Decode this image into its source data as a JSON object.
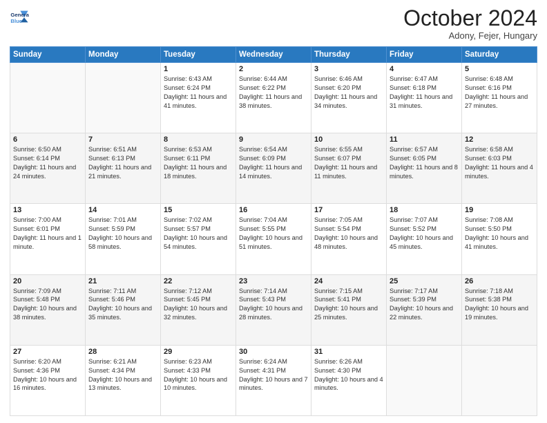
{
  "header": {
    "logo_line1": "General",
    "logo_line2": "Blue",
    "month": "October 2024",
    "location": "Adony, Fejer, Hungary"
  },
  "weekdays": [
    "Sunday",
    "Monday",
    "Tuesday",
    "Wednesday",
    "Thursday",
    "Friday",
    "Saturday"
  ],
  "weeks": [
    [
      {
        "day": "",
        "sunrise": "",
        "sunset": "",
        "daylight": ""
      },
      {
        "day": "",
        "sunrise": "",
        "sunset": "",
        "daylight": ""
      },
      {
        "day": "1",
        "sunrise": "Sunrise: 6:43 AM",
        "sunset": "Sunset: 6:24 PM",
        "daylight": "Daylight: 11 hours and 41 minutes."
      },
      {
        "day": "2",
        "sunrise": "Sunrise: 6:44 AM",
        "sunset": "Sunset: 6:22 PM",
        "daylight": "Daylight: 11 hours and 38 minutes."
      },
      {
        "day": "3",
        "sunrise": "Sunrise: 6:46 AM",
        "sunset": "Sunset: 6:20 PM",
        "daylight": "Daylight: 11 hours and 34 minutes."
      },
      {
        "day": "4",
        "sunrise": "Sunrise: 6:47 AM",
        "sunset": "Sunset: 6:18 PM",
        "daylight": "Daylight: 11 hours and 31 minutes."
      },
      {
        "day": "5",
        "sunrise": "Sunrise: 6:48 AM",
        "sunset": "Sunset: 6:16 PM",
        "daylight": "Daylight: 11 hours and 27 minutes."
      }
    ],
    [
      {
        "day": "6",
        "sunrise": "Sunrise: 6:50 AM",
        "sunset": "Sunset: 6:14 PM",
        "daylight": "Daylight: 11 hours and 24 minutes."
      },
      {
        "day": "7",
        "sunrise": "Sunrise: 6:51 AM",
        "sunset": "Sunset: 6:13 PM",
        "daylight": "Daylight: 11 hours and 21 minutes."
      },
      {
        "day": "8",
        "sunrise": "Sunrise: 6:53 AM",
        "sunset": "Sunset: 6:11 PM",
        "daylight": "Daylight: 11 hours and 18 minutes."
      },
      {
        "day": "9",
        "sunrise": "Sunrise: 6:54 AM",
        "sunset": "Sunset: 6:09 PM",
        "daylight": "Daylight: 11 hours and 14 minutes."
      },
      {
        "day": "10",
        "sunrise": "Sunrise: 6:55 AM",
        "sunset": "Sunset: 6:07 PM",
        "daylight": "Daylight: 11 hours and 11 minutes."
      },
      {
        "day": "11",
        "sunrise": "Sunrise: 6:57 AM",
        "sunset": "Sunset: 6:05 PM",
        "daylight": "Daylight: 11 hours and 8 minutes."
      },
      {
        "day": "12",
        "sunrise": "Sunrise: 6:58 AM",
        "sunset": "Sunset: 6:03 PM",
        "daylight": "Daylight: 11 hours and 4 minutes."
      }
    ],
    [
      {
        "day": "13",
        "sunrise": "Sunrise: 7:00 AM",
        "sunset": "Sunset: 6:01 PM",
        "daylight": "Daylight: 11 hours and 1 minute."
      },
      {
        "day": "14",
        "sunrise": "Sunrise: 7:01 AM",
        "sunset": "Sunset: 5:59 PM",
        "daylight": "Daylight: 10 hours and 58 minutes."
      },
      {
        "day": "15",
        "sunrise": "Sunrise: 7:02 AM",
        "sunset": "Sunset: 5:57 PM",
        "daylight": "Daylight: 10 hours and 54 minutes."
      },
      {
        "day": "16",
        "sunrise": "Sunrise: 7:04 AM",
        "sunset": "Sunset: 5:55 PM",
        "daylight": "Daylight: 10 hours and 51 minutes."
      },
      {
        "day": "17",
        "sunrise": "Sunrise: 7:05 AM",
        "sunset": "Sunset: 5:54 PM",
        "daylight": "Daylight: 10 hours and 48 minutes."
      },
      {
        "day": "18",
        "sunrise": "Sunrise: 7:07 AM",
        "sunset": "Sunset: 5:52 PM",
        "daylight": "Daylight: 10 hours and 45 minutes."
      },
      {
        "day": "19",
        "sunrise": "Sunrise: 7:08 AM",
        "sunset": "Sunset: 5:50 PM",
        "daylight": "Daylight: 10 hours and 41 minutes."
      }
    ],
    [
      {
        "day": "20",
        "sunrise": "Sunrise: 7:09 AM",
        "sunset": "Sunset: 5:48 PM",
        "daylight": "Daylight: 10 hours and 38 minutes."
      },
      {
        "day": "21",
        "sunrise": "Sunrise: 7:11 AM",
        "sunset": "Sunset: 5:46 PM",
        "daylight": "Daylight: 10 hours and 35 minutes."
      },
      {
        "day": "22",
        "sunrise": "Sunrise: 7:12 AM",
        "sunset": "Sunset: 5:45 PM",
        "daylight": "Daylight: 10 hours and 32 minutes."
      },
      {
        "day": "23",
        "sunrise": "Sunrise: 7:14 AM",
        "sunset": "Sunset: 5:43 PM",
        "daylight": "Daylight: 10 hours and 28 minutes."
      },
      {
        "day": "24",
        "sunrise": "Sunrise: 7:15 AM",
        "sunset": "Sunset: 5:41 PM",
        "daylight": "Daylight: 10 hours and 25 minutes."
      },
      {
        "day": "25",
        "sunrise": "Sunrise: 7:17 AM",
        "sunset": "Sunset: 5:39 PM",
        "daylight": "Daylight: 10 hours and 22 minutes."
      },
      {
        "day": "26",
        "sunrise": "Sunrise: 7:18 AM",
        "sunset": "Sunset: 5:38 PM",
        "daylight": "Daylight: 10 hours and 19 minutes."
      }
    ],
    [
      {
        "day": "27",
        "sunrise": "Sunrise: 6:20 AM",
        "sunset": "Sunset: 4:36 PM",
        "daylight": "Daylight: 10 hours and 16 minutes."
      },
      {
        "day": "28",
        "sunrise": "Sunrise: 6:21 AM",
        "sunset": "Sunset: 4:34 PM",
        "daylight": "Daylight: 10 hours and 13 minutes."
      },
      {
        "day": "29",
        "sunrise": "Sunrise: 6:23 AM",
        "sunset": "Sunset: 4:33 PM",
        "daylight": "Daylight: 10 hours and 10 minutes."
      },
      {
        "day": "30",
        "sunrise": "Sunrise: 6:24 AM",
        "sunset": "Sunset: 4:31 PM",
        "daylight": "Daylight: 10 hours and 7 minutes."
      },
      {
        "day": "31",
        "sunrise": "Sunrise: 6:26 AM",
        "sunset": "Sunset: 4:30 PM",
        "daylight": "Daylight: 10 hours and 4 minutes."
      },
      {
        "day": "",
        "sunrise": "",
        "sunset": "",
        "daylight": ""
      },
      {
        "day": "",
        "sunrise": "",
        "sunset": "",
        "daylight": ""
      }
    ]
  ]
}
